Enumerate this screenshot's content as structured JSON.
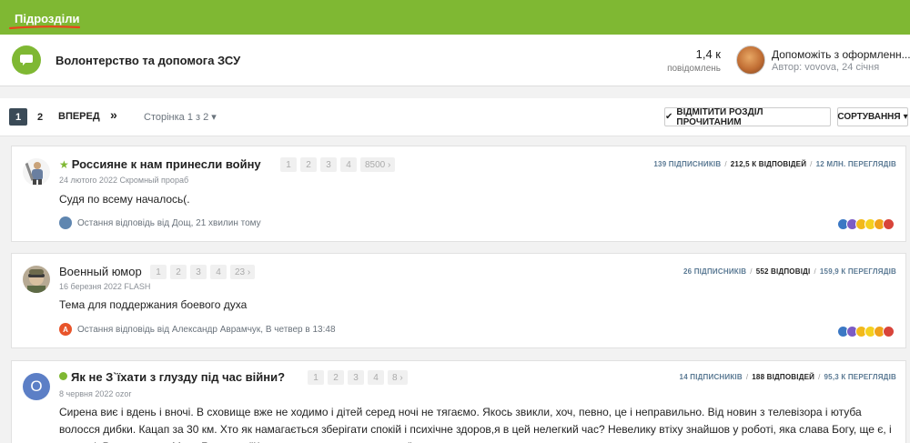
{
  "topbar": {
    "title": "Підрозділи"
  },
  "subforum": {
    "title": "Волонтерство та допомога ЗСУ",
    "posts_count": "1,4 к",
    "posts_label": "повідомлень",
    "last_post_title": "Допоможіть з оформленн...",
    "last_post_meta": "Автор: vovova, 24 січня"
  },
  "toolbar": {
    "pages": [
      "1",
      "2"
    ],
    "forward_label": "ВПЕРЕД",
    "next_glyph": "»",
    "page_of": "Сторінка 1 з 2",
    "mark_read_label": "ВІДМІТИТИ РОЗДІЛ ПРОЧИТАНИМ",
    "sort_label": "СОРТУВАННЯ"
  },
  "topics": [
    {
      "title": "Россияне к нам принесли войну",
      "pages": [
        "1",
        "2",
        "3",
        "4",
        "8500 ›"
      ],
      "meta": "24 лютого 2022 Скромный прораб",
      "body": "Судя по всему началось(.",
      "last_reply": "Остання відповідь від Дощ, 21 хвилин тому",
      "subscribers": "139 ПІДПИСНИКІВ",
      "replies": "212,5 К ВІДПОВІДЕЙ",
      "views": "12 МЛН. ПЕРЕГЛЯДІВ"
    },
    {
      "title": "Военный юмор",
      "pages": [
        "1",
        "2",
        "3",
        "4",
        "23 ›"
      ],
      "meta": "16 березня 2022 FLASH",
      "body": "Тема для поддержания боевого духа",
      "last_reply_initial": "A",
      "last_reply": "Остання відповідь від Александр Аврамчук, В четвер в 13:48",
      "subscribers": "26 ПІДПИСНИКІВ",
      "replies": "552 ВІДПОВІДІ",
      "views": "159,9 К ПЕРЕГЛЯДІВ"
    },
    {
      "avatar_letter": "O",
      "title": "Як не З`їхати з глузду під час війни?",
      "pages": [
        "1",
        "2",
        "3",
        "4",
        "8 ›"
      ],
      "meta": "8 червня 2022 ozor",
      "body": "Сирена виє і вдень і вночі. В сховище вже не ходимо і дітей серед ночі не тягаємо. Якось звикли, хоч, певно, це і неправильно. Від новин з телевізора і ютуба волосся дибки. Кацап за 30 км. Хто як намагається зберігати спокій і психічне здоров,я в цей нелегкий час? Невелику втіху знайшов у роботі, яка слава Богу, ще є, і читанні. Рекомендую: Марк Гоулстон \"Как разговаривать с мудаками\"",
      "subscribers": "14 ПІДПИСНИКІВ",
      "replies": "188 ВІДПОВІДЕЙ",
      "views": "95,3 К ПЕРЕГЛЯДІВ"
    }
  ],
  "colors": {
    "accent": "#7fb833",
    "dark": "#3a4a57",
    "stat_blue": "#5b7a94"
  }
}
